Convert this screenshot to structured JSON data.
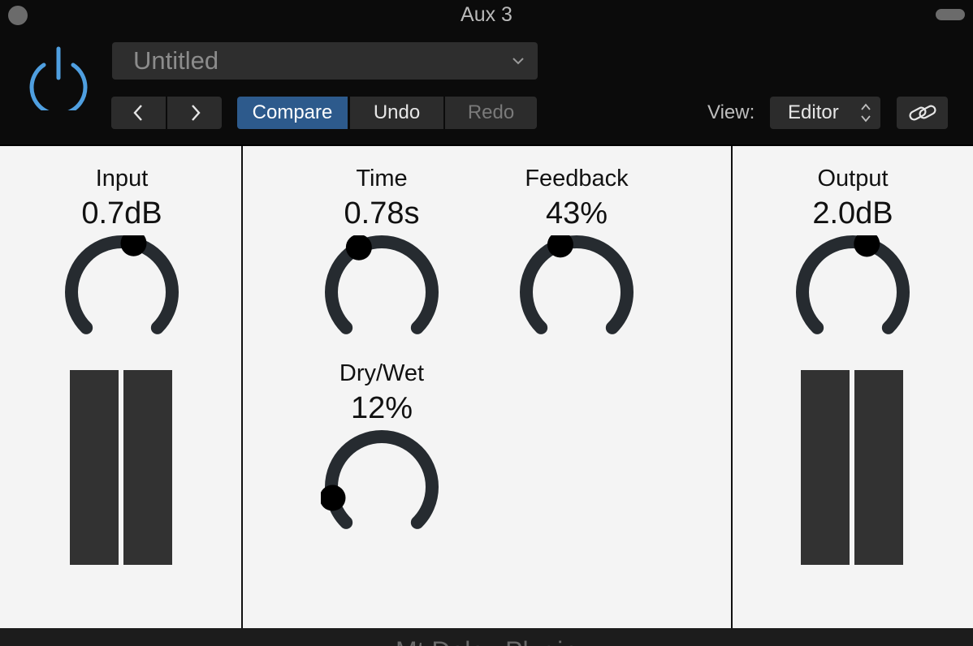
{
  "window": {
    "title": "Aux 3"
  },
  "toolbar": {
    "preset_name": "Untitled",
    "prev_icon": "chevron-left-icon",
    "next_icon": "chevron-right-icon",
    "compare_label": "Compare",
    "undo_label": "Undo",
    "redo_label": "Redo",
    "view_label": "View:",
    "view_value": "Editor",
    "accent_color": "#2d5a8c",
    "power_color": "#4f9fe0"
  },
  "plugin": {
    "name": "Mt Delay Plugin",
    "input": {
      "label": "Input",
      "value": "0.7dB",
      "position": 0.55
    },
    "time": {
      "label": "Time",
      "value": "0.78s",
      "position": 0.4
    },
    "feedback": {
      "label": "Feedback",
      "value": "43%",
      "position": 0.43
    },
    "drywet": {
      "label": "Dry/Wet",
      "value": "12%",
      "position": 0.12
    },
    "output": {
      "label": "Output",
      "value": "2.0dB",
      "position": 0.56
    }
  }
}
